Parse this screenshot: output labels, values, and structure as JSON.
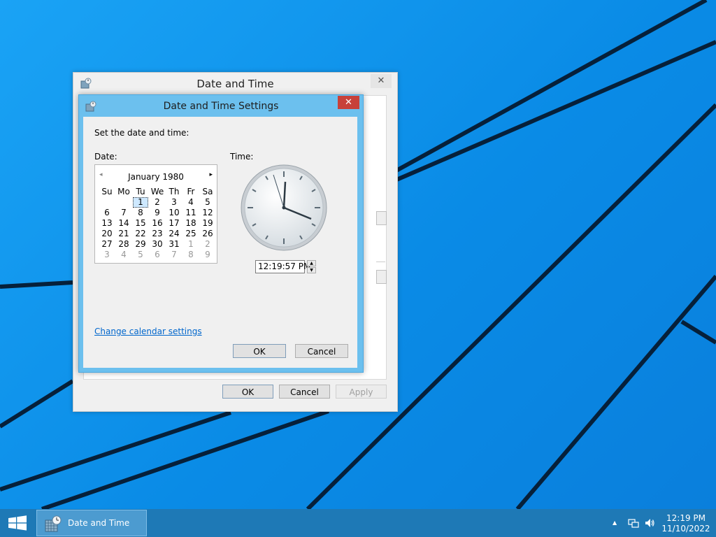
{
  "outer_dialog": {
    "title": "Date and Time",
    "close_glyph": "✕",
    "ok_label": "OK",
    "cancel_label": "Cancel",
    "apply_label": "Apply"
  },
  "inner_dialog": {
    "title": "Date and Time Settings",
    "close_glyph": "✕",
    "instruction": "Set the date and time:",
    "date_label": "Date:",
    "time_label": "Time:",
    "calendar": {
      "month": "January 1980",
      "prev_glyph": "◂",
      "next_glyph": "▸",
      "weekdays": [
        "Su",
        "Mo",
        "Tu",
        "We",
        "Th",
        "Fr",
        "Sa"
      ],
      "weeks": [
        [
          "",
          "",
          "1",
          "2",
          "3",
          "4",
          "5"
        ],
        [
          "6",
          "7",
          "8",
          "9",
          "10",
          "11",
          "12"
        ],
        [
          "13",
          "14",
          "15",
          "16",
          "17",
          "18",
          "19"
        ],
        [
          "20",
          "21",
          "22",
          "23",
          "24",
          "25",
          "26"
        ],
        [
          "27",
          "28",
          "29",
          "30",
          "31",
          "1",
          "2"
        ],
        [
          "3",
          "4",
          "5",
          "6",
          "7",
          "8",
          "9"
        ]
      ],
      "selected_day": "1"
    },
    "time_value": "12:19:57 PM",
    "spin_up": "▲",
    "spin_down": "▼",
    "change_calendar_link": "Change calendar settings",
    "ok_label": "OK",
    "cancel_label": "Cancel"
  },
  "taskbar": {
    "task_label": "Date and Time",
    "time": "12:19 PM",
    "date": "11/10/2022",
    "tray_chevron": "▲"
  },
  "icons": {
    "start": "windows-logo-icon",
    "app": "date-time-app-icon",
    "network": "network-icon",
    "volume": "volume-icon"
  },
  "colors": {
    "desktop": "#0d8fe8",
    "inner_frame": "#6cc0ee",
    "close_red": "#c7413a",
    "taskbar": "#1e79b6",
    "link": "#0066cc"
  }
}
